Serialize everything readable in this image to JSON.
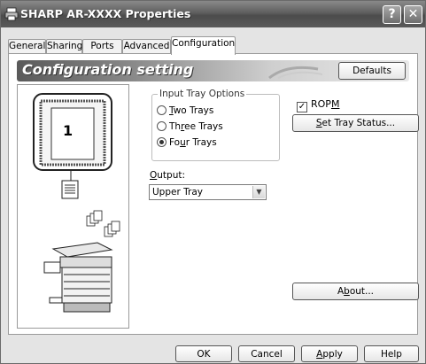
{
  "window": {
    "title": "SHARP AR-XXXX Properties",
    "help_glyph": "?",
    "close_glyph": "✕"
  },
  "tabs": [
    {
      "label": "General"
    },
    {
      "label": "Sharing"
    },
    {
      "label": "Ports"
    },
    {
      "label": "Advanced"
    },
    {
      "label": "Configuration",
      "active": true
    }
  ],
  "header": {
    "title": "Configuration setting",
    "defaults_button": "Defaults"
  },
  "tray_preview": {
    "tray_number": "1"
  },
  "input_tray_options": {
    "legend": "Input Tray Options",
    "options": [
      {
        "label_pre": "",
        "mnemonic": "T",
        "label_post": "wo Trays",
        "selected": false
      },
      {
        "label_pre": "Th",
        "mnemonic": "r",
        "label_post": "ee Trays",
        "selected": false
      },
      {
        "label_pre": "Fo",
        "mnemonic": "u",
        "label_post": "r Trays",
        "selected": true
      }
    ]
  },
  "output": {
    "label_mnemonic": "O",
    "label_rest": "utput:",
    "selected": "Upper Tray"
  },
  "ropm": {
    "label_pre": "ROP",
    "mnemonic": "M",
    "checked": true
  },
  "buttons": {
    "set_tray_status_mnemonic": "S",
    "set_tray_status_rest": "et Tray Status...",
    "about_pre": "A",
    "about_mnemonic": "b",
    "about_post": "out...",
    "ok": "OK",
    "cancel": "Cancel",
    "apply_mnemonic": "A",
    "apply_rest": "pply",
    "help": "Help"
  }
}
